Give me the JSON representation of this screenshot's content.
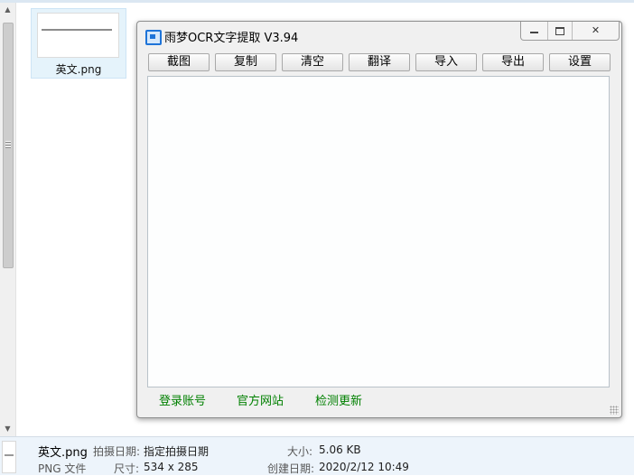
{
  "file_item": {
    "name": "英文.png"
  },
  "app": {
    "title": "雨梦OCR文字提取 V3.94",
    "toolbar": [
      "截图",
      "复制",
      "清空",
      "翻译",
      "导入",
      "导出",
      "设置"
    ],
    "text_content": "",
    "footer_links": [
      "登录账号",
      "官方网站",
      "检测更新"
    ]
  },
  "details": {
    "filename": "英文.png",
    "type": "PNG 文件",
    "shot_date_label": "拍摄日期:",
    "shot_date_value": "指定拍摄日期",
    "dimensions_label": "尺寸:",
    "dimensions_value": "534 x 285",
    "size_label": "大小:",
    "size_value": "5.06 KB",
    "created_label": "创建日期:",
    "created_value": "2020/2/12 10:49"
  },
  "icons": {
    "scroll_up": "▲",
    "scroll_down": "▼",
    "close": "✕"
  },
  "colors": {
    "footer_link": "#008000",
    "selection_bg": "#e5f3fb",
    "details_bg": "#edf4fb",
    "app_icon": "#1e74d8"
  }
}
